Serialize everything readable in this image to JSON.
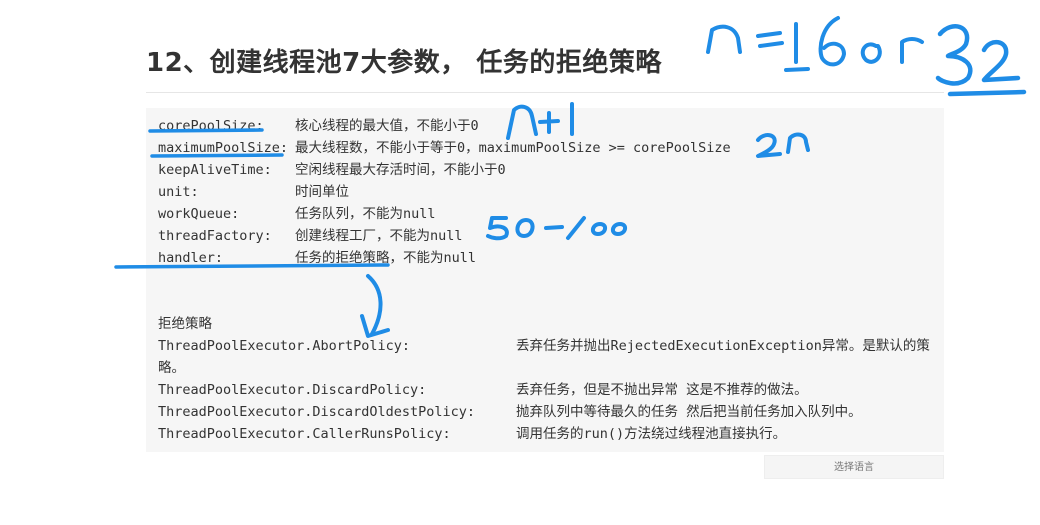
{
  "heading": "12、创建线程池7大参数， 任务的拒绝策略",
  "params": [
    {
      "name": "corePoolSize:",
      "desc": "核心线程的最大值，不能小于0"
    },
    {
      "name": "maximumPoolSize:",
      "desc": "最大线程数，不能小于等于0，maximumPoolSize >= corePoolSize"
    },
    {
      "name": "keepAliveTime:",
      "desc": "空闲线程最大存活时间，不能小于0"
    },
    {
      "name": "unit:",
      "desc": "时间单位"
    },
    {
      "name": "workQueue:",
      "desc": "任务队列，不能为null"
    },
    {
      "name": "threadFactory:",
      "desc": "创建线程工厂，不能为null"
    },
    {
      "name": "handler:",
      "desc": "任务的拒绝策略，不能为null"
    }
  ],
  "policies_heading": "拒绝策略",
  "policies": [
    {
      "name": "ThreadPoolExecutor.AbortPolicy:",
      "desc": "丢弃任务并抛出RejectedExecutionException异常。是默认的策",
      "desc_cont": "略。"
    },
    {
      "name": "ThreadPoolExecutor.DiscardPolicy:",
      "desc": "丢弃任务，但是不抛出异常 这是不推荐的做法。"
    },
    {
      "name": "ThreadPoolExecutor.DiscardOldestPolicy:",
      "desc": "抛弃队列中等待最久的任务 然后把当前任务加入队列中。"
    },
    {
      "name": "ThreadPoolExecutor.CallerRunsPolicy:",
      "desc": "调用任务的run()方法绕过线程池直接执行。"
    }
  ],
  "language_button": "选择语言",
  "annotation_color": "#1f8ce6"
}
